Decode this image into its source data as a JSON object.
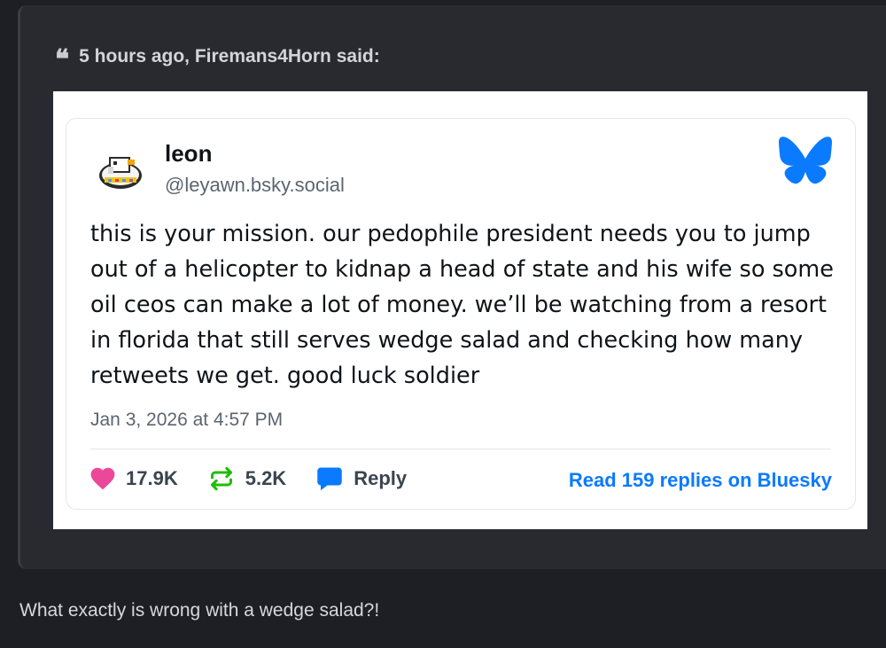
{
  "quote": {
    "mark": "❝",
    "header": "5 hours ago, Firemans4Horn said:"
  },
  "post": {
    "display_name": "leon",
    "handle": "@leyawn.bsky.social",
    "text": "this is your mission. our pedophile president needs you to jump out of a helicopter to kidnap a head of state and his wife so some oil ceos can make a lot of money. we’ll be watching from a resort in florida that still serves wedge salad and checking how many retweets we get. good luck soldier",
    "date": "Jan 3, 2026 at 4:57 PM",
    "likes": "17.9K",
    "reposts": "5.2K",
    "reply_label": "Reply",
    "read_replies": "Read 159 replies on Bluesky"
  },
  "reply": {
    "text": "What exactly is wrong with a wedge salad?!"
  },
  "colors": {
    "page_bg": "#1d1f24",
    "quote_bg": "#282a30",
    "bluesky_blue": "#0a7aff",
    "like_pink": "#ec4899",
    "repost_green": "#20bc07"
  },
  "icons": {
    "quote": "quote-icon",
    "avatar": "pixel-bird-avatar",
    "logo": "bluesky-butterfly-icon",
    "like": "heart-icon",
    "repost": "repost-icon",
    "reply": "speech-bubble-icon"
  }
}
